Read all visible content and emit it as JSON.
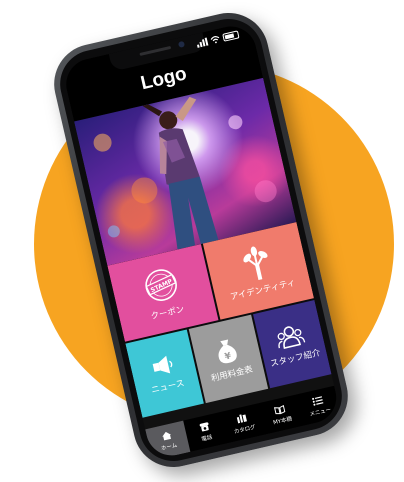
{
  "colors": {
    "background_disc": "#f7a421",
    "tile_coupon": "#e24f9e",
    "tile_identity": "#f07b6c",
    "tile_news": "#3ec7d6",
    "tile_fees": "#9c9c9c",
    "tile_staff": "#3a2f86"
  },
  "status_bar": {
    "icons": [
      "signal-icon",
      "wifi-icon",
      "battery-icon"
    ]
  },
  "header": {
    "logo_text": "Logo"
  },
  "hero": {
    "image": "concert-dancer-photo"
  },
  "tiles": {
    "coupon": {
      "label": "クーポン",
      "stamp_text": "STAMP",
      "icon": "stamp-icon"
    },
    "identity": {
      "label": "アイデンティティ",
      "icon": "tree-icon"
    },
    "news": {
      "label": "ニュース",
      "icon": "megaphone-icon"
    },
    "fees": {
      "label": "利用料金表",
      "icon": "money-bag-icon"
    },
    "staff": {
      "label": "スタッフ紹介",
      "icon": "group-icon"
    }
  },
  "bottom_nav": {
    "items": [
      {
        "label": "ホーム",
        "icon": "home-icon",
        "active": true
      },
      {
        "label": "電話",
        "icon": "phone-icon",
        "active": false
      },
      {
        "label": "カタログ",
        "icon": "catalog-icon",
        "active": false
      },
      {
        "label": "MY本棚",
        "icon": "book-icon",
        "active": false
      },
      {
        "label": "メニュー",
        "icon": "menu-icon",
        "active": false
      }
    ]
  }
}
